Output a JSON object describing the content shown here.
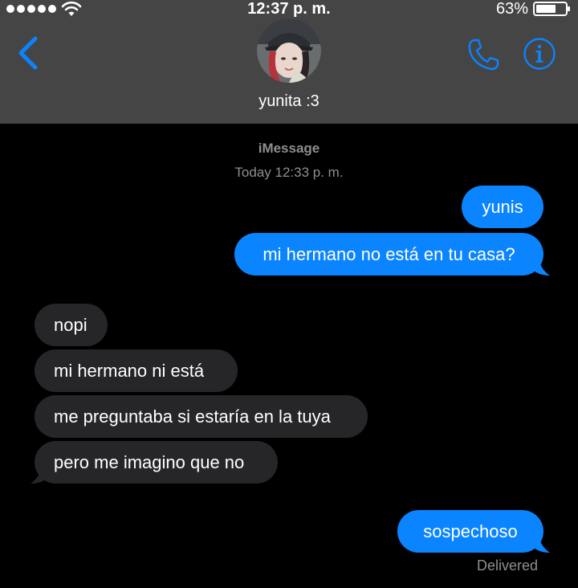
{
  "status_bar": {
    "time": "12:37 p. m.",
    "battery": "63%"
  },
  "header": {
    "contact_name": "yunita :3"
  },
  "conversation": {
    "service": "iMessage",
    "timestamp": "Today 12:33 p. m.",
    "messages": [
      {
        "from": "me",
        "text": "yunis"
      },
      {
        "from": "me",
        "text": "mi hermano no está en tu casa?"
      },
      {
        "from": "contact",
        "text": "nopi"
      },
      {
        "from": "contact",
        "text": "mi hermano ni está"
      },
      {
        "from": "contact",
        "text": "me preguntaba si estaría en la tuya"
      },
      {
        "from": "contact",
        "text": "pero me imagino que no"
      },
      {
        "from": "me",
        "text": "sospechoso"
      }
    ],
    "delivery_status": "Delivered"
  },
  "colors": {
    "header_bg": "#454545",
    "accent": "#0a84ff",
    "sent_bubble": "#0a84ff",
    "received_bubble": "#262628",
    "meta_text": "#8e8e93"
  },
  "icons": {
    "back": "chevron-left-icon",
    "call": "phone-icon",
    "details": "info-icon",
    "signal": "signal-dots-icon",
    "wifi": "wifi-icon",
    "battery": "battery-icon"
  }
}
